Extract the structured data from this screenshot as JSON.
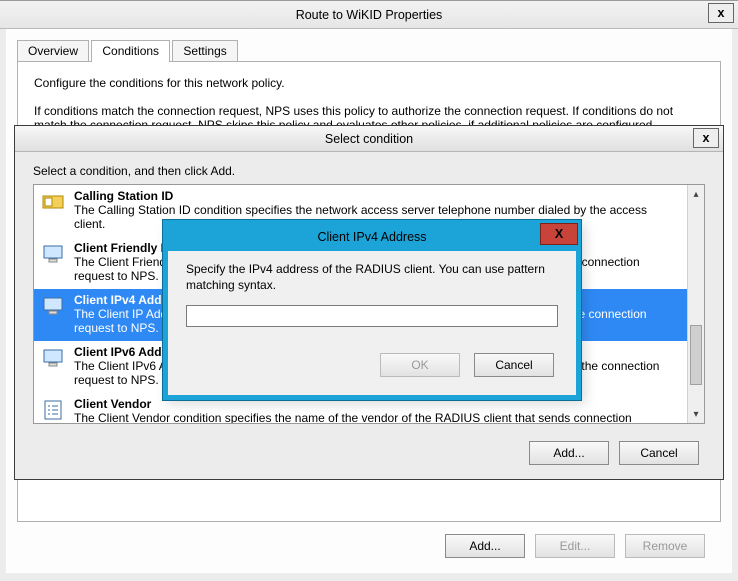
{
  "outer": {
    "title": "Route to WiKID Properties",
    "close": "x"
  },
  "tabs": {
    "overview": "Overview",
    "conditions": "Conditions",
    "settings": "Settings"
  },
  "conditions_pane": {
    "line1": "Configure the conditions for this network policy.",
    "line2": "If conditions match the connection request, NPS uses this policy to authorize the connection request. If conditions do not match the connection request, NPS skips this policy and evaluates other policies, if additional policies are configured.",
    "add": "Add...",
    "edit": "Edit...",
    "remove": "Remove"
  },
  "select": {
    "title": "Select condition",
    "close": "x",
    "prompt": "Select a condition, and then click Add.",
    "add": "Add...",
    "cancel": "Cancel",
    "items": [
      {
        "title": "Calling Station ID",
        "desc": "The Calling Station ID condition specifies the network access server telephone number dialed by the access client."
      },
      {
        "title": "Client Friendly Name",
        "desc": "The Client Friendly Name condition specifies the name of the RADIUS client that forwarded the connection request to NPS."
      },
      {
        "title": "Client IPv4 Address",
        "desc": "The Client IP Address condition specifies the IP address of the RADIUS client that forwarded the connection request to NPS."
      },
      {
        "title": "Client IPv6 Address",
        "desc": "The Client IPv6 Address condition specifies the IP address of the RADIUS client that forwarded the connection request to NPS."
      },
      {
        "title": "Client Vendor",
        "desc": "The Client Vendor condition specifies the name of the vendor of the RADIUS client that sends connection requests to NPS."
      }
    ]
  },
  "ipv4": {
    "title": "Client IPv4 Address",
    "close": "X",
    "prompt": "Specify the IPv4 address of the RADIUS client. You can use pattern matching syntax.",
    "value": "",
    "ok": "OK",
    "cancel": "Cancel"
  }
}
